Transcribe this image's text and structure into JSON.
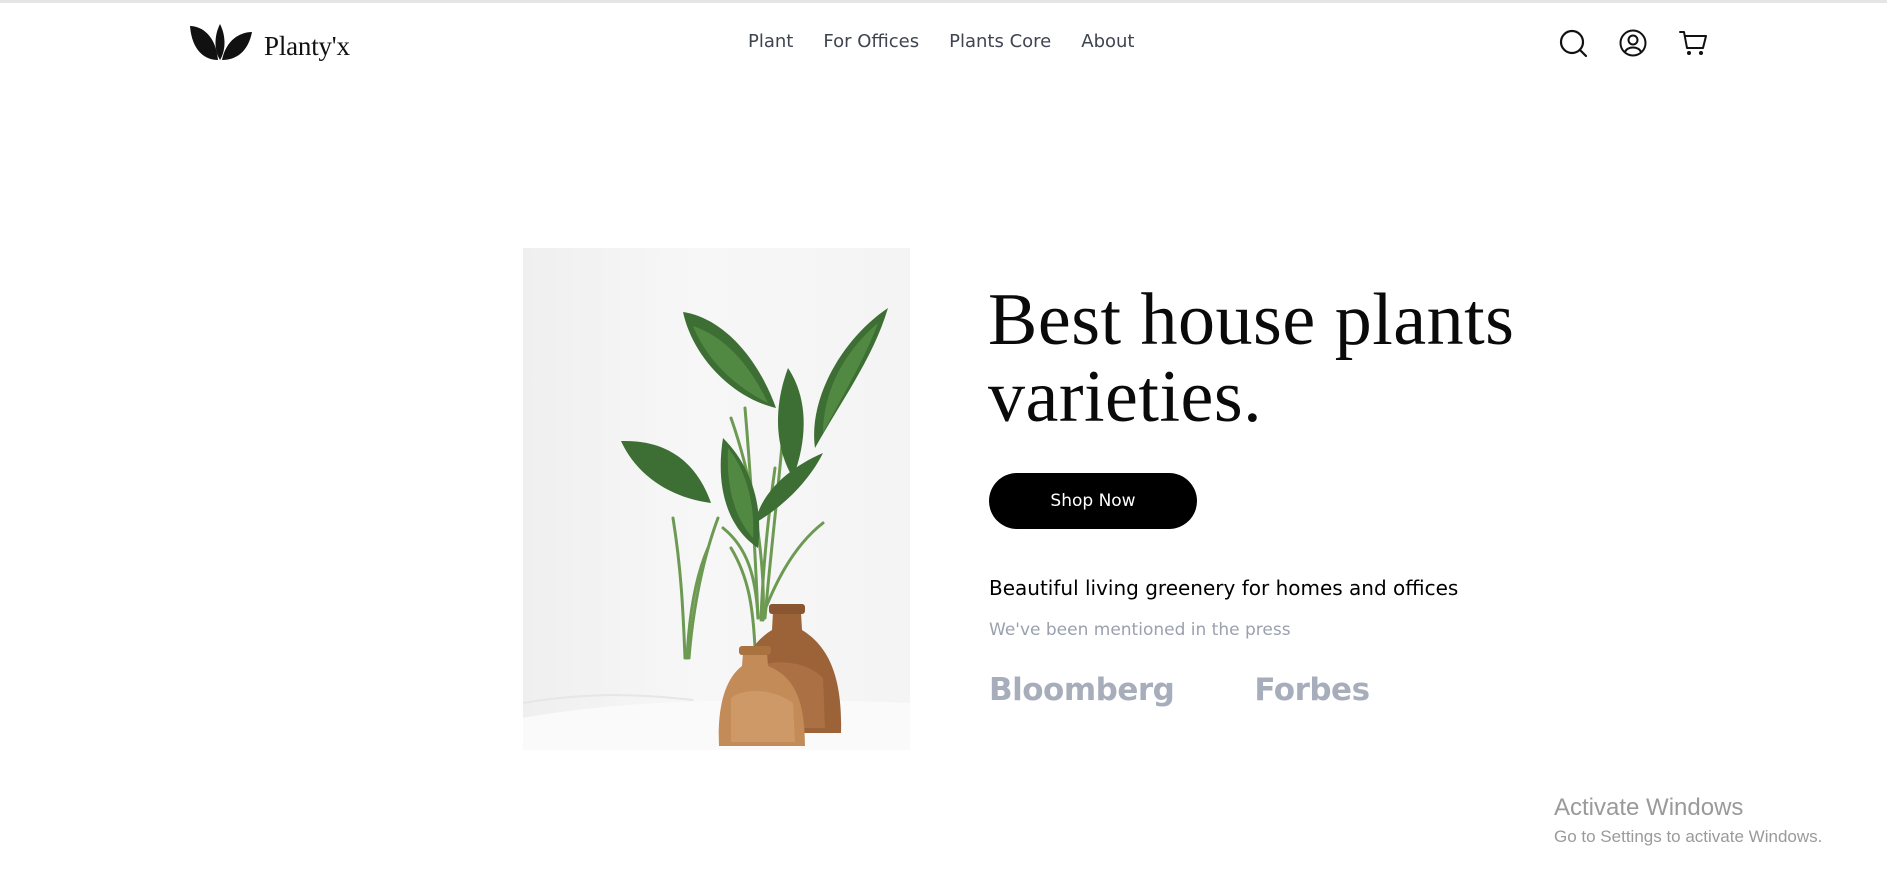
{
  "header": {
    "brand": "Planty'x",
    "nav": [
      "Plant",
      "For Offices",
      "Plants Core",
      "About"
    ],
    "icons": [
      "search-icon",
      "user-icon",
      "cart-icon"
    ]
  },
  "hero": {
    "headline_line1": "Best house plants",
    "headline_line2": "varieties.",
    "cta_label": "Shop Now",
    "tagline": "Beautiful living greenery for homes and offices",
    "press_note": "We've been mentioned in the press",
    "press_logos": [
      "Bloomberg",
      "Forbes"
    ]
  },
  "watermark": {
    "title": "Activate Windows",
    "subtitle": "Go to Settings to activate Windows."
  },
  "colors": {
    "button_bg": "#000000",
    "muted_text": "#9aa0ad",
    "nav_text": "#3f4450",
    "leaf_green": "#3f7f3f",
    "vase_wood": "#b07a4c"
  }
}
